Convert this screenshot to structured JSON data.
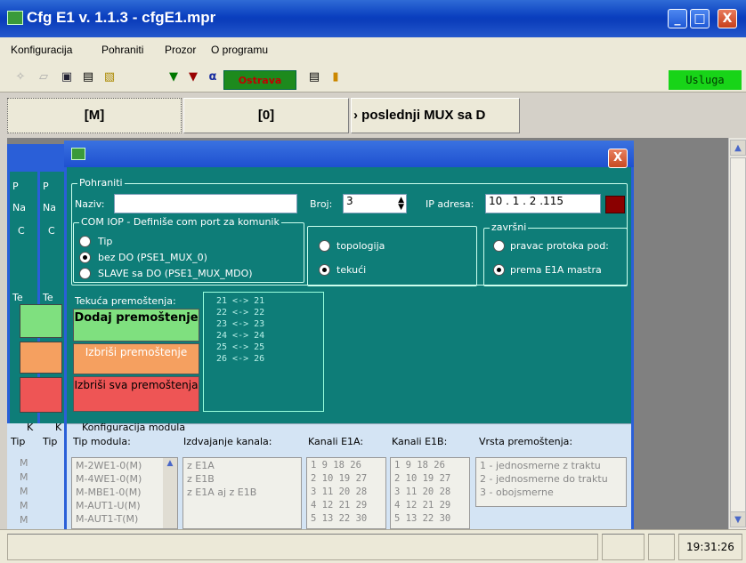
{
  "window": {
    "title": "Cfg E1 v. 1.1.3 - cfgE1.mpr",
    "min": "_",
    "max": "□",
    "close": "X"
  },
  "menu": [
    "Konfiguracija",
    "Pohraniti",
    "Prozor",
    "O programu"
  ],
  "toolbar": {
    "location_label": "Ostrava",
    "status_label": "Usluga"
  },
  "tabs": [
    "[M]",
    "[0]",
    "› poslednji MUX sa D"
  ],
  "background_windows": {
    "title_letters": [
      "P",
      "P"
    ],
    "labels": [
      "Na",
      "Na",
      "C",
      "C",
      "Te",
      "Te",
      "K",
      "K",
      "Tip",
      "Tip"
    ],
    "list_letters": [
      "M",
      "M",
      "M",
      "M",
      "M"
    ]
  },
  "dialog": {
    "close": "X",
    "pohraniti_group": "Pohraniti",
    "naziv_label": "Naziv:",
    "naziv_value": "",
    "broj_label": "Broj:",
    "broj_value": "3",
    "ip_label": "IP adresa:",
    "ip_value": "10 . 1 . 2 .115",
    "com_group": "COM IOP - Definiše com port za komunik",
    "com_options": [
      {
        "label": "Tip",
        "selected": false
      },
      {
        "label": "bez DO (PSE1_MUX_0)",
        "selected": true
      },
      {
        "label": "SLAVE sa DO (PSE1_MUX_MDO)",
        "selected": false
      }
    ],
    "mode_options": [
      {
        "label": "topologija",
        "selected": false
      },
      {
        "label": "tekući",
        "selected": true
      }
    ],
    "zavrsni_group": "završni",
    "zavrsni_options": [
      {
        "label": "pravac protoka pod:",
        "selected": false
      },
      {
        "label": "prema E1A mastra",
        "selected": true
      }
    ],
    "tekuca_label": "Tekuća premoštenja:",
    "btn_add": "Dodaj premoštenje",
    "btn_delete": "Izbriši premoštenje",
    "btn_delete_all": "Izbriši sva premoštenja",
    "pairs": [
      "21  <->  21",
      "22  <->  22",
      "23  <->  23",
      "24  <->  24",
      "25  <->  25",
      "26  <->  26"
    ]
  },
  "konfiguracija": {
    "group": "Konfiguracija modula",
    "col_tip": "Tip modula:",
    "col_izdvajanje": "Izdvajanje kanala:",
    "col_e1a": "Kanali E1A:",
    "col_e1b": "Kanali E1B:",
    "col_vrsta": "Vrsta premoštenja:",
    "tip_items": [
      "M-2WE1-0(M)",
      "M-4WE1-0(M)",
      "M-MBE1-0(M)",
      "M-AUT1-U(M)",
      "M-AUT1-T(M)"
    ],
    "izdvajanje_items": [
      "z E1A",
      "z E1B",
      "z E1A aj z E1B"
    ],
    "e1a_rows": [
      "1   9  18 26",
      "2  10 19 27",
      "3  11 20 28",
      "4  12 21 29",
      "5  13 22 30"
    ],
    "e1b_rows": [
      "1   9  18 26",
      "2  10 19 27",
      "3  11 20 28",
      "4  12 21 29",
      "5  13 22 30"
    ],
    "vrsta_items": [
      "1 - jednosmerne z traktu",
      "2 - jednosmerne do traktu",
      "3 - obojsmerne"
    ]
  },
  "statusbar": {
    "time": "19:31:26"
  }
}
